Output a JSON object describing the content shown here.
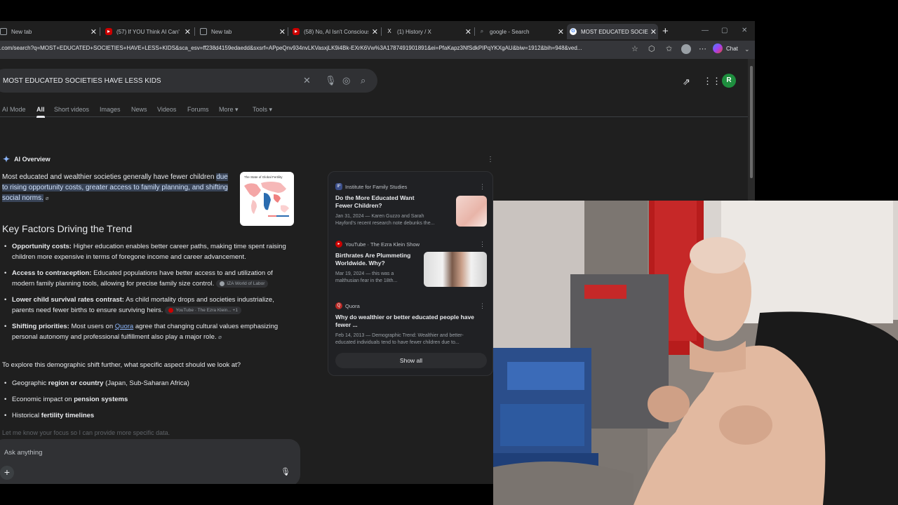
{
  "browser": {
    "tabs": [
      {
        "label": "New tab",
        "icon": "page-icon"
      },
      {
        "label": "(57) If YOU Think AI Can't Re",
        "icon": "youtube-icon"
      },
      {
        "label": "New tab",
        "icon": "page-icon"
      },
      {
        "label": "(58) No, AI Isn't Conscious. F",
        "icon": "youtube-icon"
      },
      {
        "label": "(1) History / X",
        "icon": "x-icon"
      },
      {
        "label": "google - Search",
        "icon": "search-icon"
      },
      {
        "label": "MOST EDUCATED SOCIETIE",
        "icon": "google-icon"
      }
    ],
    "url": ".com/search?q=MOST+EDUCATED+SOCIETIES+HAVE+LESS+KIDS&sca_esv=ff238d4159edaedd&sxsrf=APpeQnv934nvLKVasxjLK9i4Bk-EXrK6Vw%3A1787491901891&ei=PfaKapz3NfSdkPIPqYKXgAU&biw=1912&bih=948&ved...",
    "chat_label": "Chat"
  },
  "search": {
    "query": "MOST EDUCATED SOCIETIES HAVE LESS KIDS",
    "profile_initial": "R",
    "nav_tabs": [
      "AI Mode",
      "All",
      "Short videos",
      "Images",
      "News",
      "Videos",
      "Forums",
      "More",
      "Tools"
    ]
  },
  "ai": {
    "label": "AI Overview",
    "intro_plain": "Most educated and wealthier societies generally have fewer children",
    "intro_highlight": "due to rising opportunity costs, greater access to family planning, and shifting social norms",
    "heading": "Key Factors Driving the Trend",
    "factors": [
      {
        "title": "Opportunity costs:",
        "text": "Higher education enables better career paths, making time spent raising children more expensive in terms of foregone income and career advancement."
      },
      {
        "title": "Access to contraception:",
        "text": "Educated populations have better access to and utilization of modern family planning tools, allowing for precise family size control.",
        "chip": "IZA World of Labor"
      },
      {
        "title": "Lower child survival rates contrast:",
        "text": "As child mortality drops and societies industrialize, parents need fewer births to ensure surviving heirs.",
        "chip": "YouTube · The Ezra Klein...",
        "chip_extra": "+1"
      },
      {
        "title": "Shifting priorities:",
        "text_before": "Most users on",
        "link": "Quora",
        "text_after": "agree that changing cultural values emphasizing personal autonomy and professional fulfillment also play a major role."
      }
    ],
    "explore": "To explore this demographic shift further, what specific aspect should we look at?",
    "aspects": [
      {
        "pre": "Geographic",
        "bold": "region or country",
        "post": "(Japan, Sub-Saharan Africa)"
      },
      {
        "pre": "Economic impact on",
        "bold": "pension systems",
        "post": ""
      },
      {
        "pre": "Historical",
        "bold": "fertility timelines",
        "post": ""
      }
    ],
    "faded": "Let me know your focus so I can provide more specific data.",
    "ask_placeholder": "Ask anything"
  },
  "sources": [
    {
      "site": "Institute for Family Studies",
      "title": "Do the More Educated Want Fewer Children?",
      "snippet": "Jan 31, 2024 — Karen Guzzo and Sarah Hayford's recent research note debunks the...",
      "color": "#3c4f8a"
    },
    {
      "site": "YouTube · The Ezra Klein Show",
      "title": "Birthrates Are Plummeting Worldwide. Why?",
      "snippet": "Mar 19, 2024 — this was a malthusian fear in the 18th...",
      "color": "#cc0000"
    },
    {
      "site": "Quora",
      "title": "Why do wealthier or better educated people have fewer ...",
      "snippet": "Feb 14, 2013 — Demographic Trend: Wealthier and better-educated individuals tend to have fewer children due to...",
      "color": "#b92b27"
    }
  ],
  "show_all": "Show all",
  "thumb_caption": "The State of Global Fertility"
}
